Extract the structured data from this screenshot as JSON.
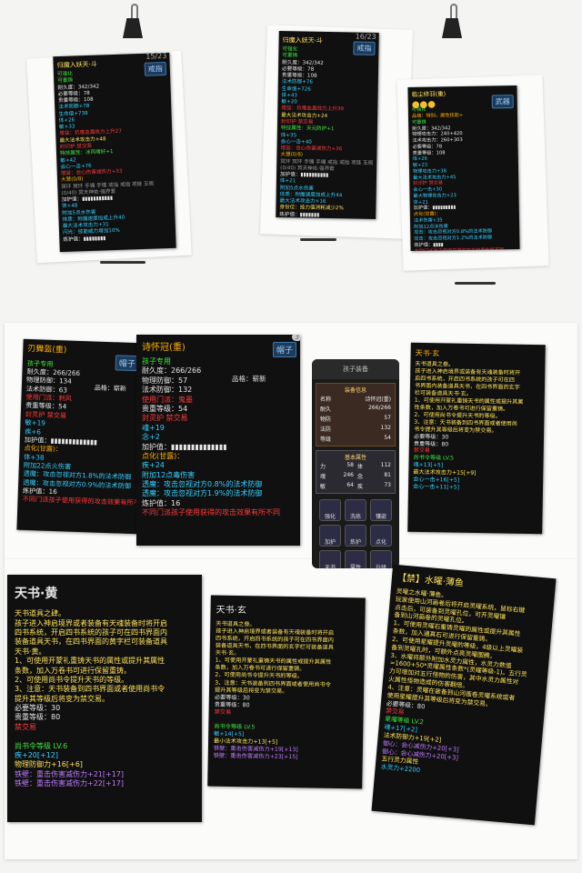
{
  "card1": {
    "title": "归魔入妖天·斗",
    "badge": "戒指",
    "pagemark": "15/23",
    "lines": [
      {
        "t": "可强化",
        "c": "grn"
      },
      {
        "t": "可重铸",
        "c": "grn"
      },
      {
        "t": "耐久度：342/342",
        "c": "wht"
      },
      {
        "t": "必要等级：78",
        "c": "wht"
      },
      {
        "t": "贵重等级：108",
        "c": "wht"
      },
      {
        "t": "法术防御+78",
        "c": "cyn"
      },
      {
        "t": "生命值+739",
        "c": "cyn"
      },
      {
        "t": "体+26",
        "c": "cyn"
      },
      {
        "t": "敏+33",
        "c": "cyn"
      },
      {
        "t": "增益：抗嗜血蛊效力上升27",
        "c": "red"
      },
      {
        "t": "最大法术攻击力+48",
        "c": "yel"
      },
      {
        "t": "封印护 禁交易",
        "c": "red"
      },
      {
        "t": "特技属性：冰风嗜好+1",
        "c": "grn"
      },
      {
        "t": "敏+42",
        "c": "cyn"
      },
      {
        "t": "会心一击+76",
        "c": "cyn"
      },
      {
        "t": "增益：会心伤害减伤力+33",
        "c": "red"
      },
      {
        "t": "大慧(0/8)",
        "c": "orn"
      },
      {
        "t": "冥环 冥环 手镯 手镯 戒指 戒指 项链 玉佩",
        "c": "gry"
      },
      {
        "t": "(0/40) 冥天神佑·强界套",
        "c": "gry"
      },
      {
        "t": "加护值：▮▮▮▮▮▮▮▮▮▮▮",
        "c": "wht"
      },
      {
        "t": "体+48",
        "c": "cyn"
      },
      {
        "t": "附加5点水伤害",
        "c": "cyn"
      },
      {
        "t": "体质：附魔速度加成上升40",
        "c": "cyn"
      },
      {
        "t": "最大法术攻击力+31",
        "c": "cyn"
      },
      {
        "t": "闪光：技能威力增加10%",
        "c": "cyn"
      },
      {
        "t": "炼护值：▮▮▮▮▮▮▮▮",
        "c": "wht"
      }
    ]
  },
  "card2": {
    "title": "归魔入妖天·斗",
    "badge": "戒指",
    "pagemark": "16/23",
    "lines": [
      {
        "t": "可强化",
        "c": "grn"
      },
      {
        "t": "可重铸",
        "c": "grn"
      },
      {
        "t": "耐久度：342/342",
        "c": "wht"
      },
      {
        "t": "必要等级：78",
        "c": "wht"
      },
      {
        "t": "贵重等级：108",
        "c": "wht"
      },
      {
        "t": "法术防御+76",
        "c": "cyn"
      },
      {
        "t": "生命值+726",
        "c": "cyn"
      },
      {
        "t": "体+43",
        "c": "cyn"
      },
      {
        "t": "敏+20",
        "c": "cyn"
      },
      {
        "t": "增益：抗嗜血蛊效力上升39",
        "c": "red"
      },
      {
        "t": "最大法术攻击力+24",
        "c": "yel"
      },
      {
        "t": "封印护 禁交易",
        "c": "red"
      },
      {
        "t": "特技属性：天元防护+1",
        "c": "grn"
      },
      {
        "t": "体+35",
        "c": "cyn"
      },
      {
        "t": "会心一击+40",
        "c": "cyn"
      },
      {
        "t": "增益：会心伤害减伤力+36",
        "c": "red"
      },
      {
        "t": "大慧(0/8)",
        "c": "orn"
      },
      {
        "t": "冥环 冥环 手镯 手镯 戒指 戒指 项链 玉佩",
        "c": "gry"
      },
      {
        "t": "(0/40) 冥天神佑·强界套",
        "c": "gry"
      },
      {
        "t": "加护值：▮▮▮▮▮▮▮▮▮▮",
        "c": "wht"
      },
      {
        "t": "体+21",
        "c": "cyn"
      },
      {
        "t": "附加5点水伤害",
        "c": "cyn"
      },
      {
        "t": "体质：附魔速度加成上升44",
        "c": "cyn"
      },
      {
        "t": "最大法术攻击力+16",
        "c": "cyn"
      },
      {
        "t": "身份位：技力值消耗减少2%",
        "c": "yel"
      },
      {
        "t": "炼护值：▮▮▮▮▮▮▮",
        "c": "wht"
      }
    ]
  },
  "card3": {
    "title": "临尘修羽(重)",
    "badge": "武器",
    "pagemark": "",
    "lines": [
      {
        "t": "可强化",
        "c": "grn"
      },
      {
        "t": "品格：特别，属性技能+",
        "c": "orn"
      },
      {
        "t": "可重铸",
        "c": "grn"
      },
      {
        "t": "耐久度：342/342",
        "c": "wht"
      },
      {
        "t": "物理攻击力：240+420",
        "c": "wht"
      },
      {
        "t": "法术攻击力：260+303",
        "c": "wht"
      },
      {
        "t": "必要等级：78",
        "c": "wht"
      },
      {
        "t": "贵重等级：108",
        "c": "wht"
      },
      {
        "t": "体+26",
        "c": "cyn"
      },
      {
        "t": "敏+23",
        "c": "cyn"
      },
      {
        "t": "物理攻击力+38",
        "c": "cyn"
      },
      {
        "t": "最大法术攻击力+45",
        "c": "cyn"
      },
      {
        "t": "封印护 禁交易",
        "c": "red"
      },
      {
        "t": "会心一击+30",
        "c": "cyn"
      },
      {
        "t": "最大物理攻击力+23",
        "c": "cyn"
      },
      {
        "t": "体+21",
        "c": "cyn"
      },
      {
        "t": "加护值：▮▮▮▮▮▮▮▮▮",
        "c": "wht"
      },
      {
        "t": "点化(甘露)：",
        "c": "orn"
      },
      {
        "t": "法术伤害+35",
        "c": "cyn"
      },
      {
        "t": "附加12点冰伤害",
        "c": "cyn"
      },
      {
        "t": "攻击：攻击忽视对方0.8%的法术防御",
        "c": "cyn"
      },
      {
        "t": "攻击：攻击忽视对方1.2%的法术防御",
        "c": "cyn"
      },
      {
        "t": "炼护值：▮▮▮▮",
        "c": "wht"
      },
      {
        "t": "不同门派孩子使用获得的攻击效果有所不同",
        "c": "red"
      }
    ]
  },
  "card4": {
    "title": "刃舞盔(重)",
    "badge": "帽子",
    "lines": [
      {
        "t": "孩子专用",
        "c": "grn"
      },
      {
        "t": "耐久度：266/266",
        "c": "wht"
      },
      {
        "t": "物理防御：134",
        "c": "wht"
      },
      {
        "t": "法术防御：63",
        "c": "wht"
      },
      {
        "t": "使用门派：刺风",
        "c": "red"
      },
      {
        "t": "贵重等级：54",
        "c": "wht"
      },
      {
        "t": "封灵护 禁交易",
        "c": "red"
      },
      {
        "t": "敏+19",
        "c": "cyn"
      },
      {
        "t": "疾+6",
        "c": "cyn"
      },
      {
        "t": "加护值：▮▮▮▮▮▮▮▮▮▮▮▮▮",
        "c": "wht"
      },
      {
        "t": "点化(甘露)：",
        "c": "orn"
      },
      {
        "t": "体+38",
        "c": "cyn"
      },
      {
        "t": "附加22点火伤害",
        "c": "cyn"
      },
      {
        "t": "透魔：攻击忽视对方1.8%的法术防御",
        "c": "cyn"
      },
      {
        "t": "透魔：攻击忽视对方0.9%的法术防御",
        "c": "cyn"
      },
      {
        "t": "炼护值：16",
        "c": "wht"
      },
      {
        "t": "不同门派孩子使用获得的攻击效果有所不同",
        "c": "red"
      }
    ],
    "quality": "品格：崭新"
  },
  "card5": {
    "title": "诗怀冠(重)",
    "badge": "帽子",
    "pagemark": "3",
    "lines": [
      {
        "t": "孩子专用",
        "c": "grn"
      },
      {
        "t": "耐久度：266/266",
        "c": "wht"
      },
      {
        "t": "物理防御：57",
        "c": "wht"
      },
      {
        "t": "法术防御：132",
        "c": "wht"
      },
      {
        "t": "使用门派：鬼墨",
        "c": "red"
      },
      {
        "t": "贵重等级：54",
        "c": "wht"
      },
      {
        "t": "封灵护 禁交易",
        "c": "red"
      },
      {
        "t": "魂+19",
        "c": "cyn"
      },
      {
        "t": "念+2",
        "c": "cyn"
      },
      {
        "t": "加护值：▮▮▮▮▮▮▮▮▮▮▮▮▮▮",
        "c": "wht"
      },
      {
        "t": "点化(甘露)：",
        "c": "orn"
      },
      {
        "t": "疾+24",
        "c": "cyn"
      },
      {
        "t": "附加12点毒伤害",
        "c": "cyn"
      },
      {
        "t": "透魔：攻击忽视对方0.8%的法术防御",
        "c": "cyn"
      },
      {
        "t": "透魔：攻击忽视对方1.9%的法术防御",
        "c": "cyn"
      },
      {
        "t": "炼护值：16",
        "c": "wht"
      },
      {
        "t": "不同门派孩子使用获得的攻击效果有所不同",
        "c": "red"
      }
    ],
    "quality": "品格：崭新"
  },
  "phone": {
    "title": "孩子装备",
    "panel_title": "装备信息",
    "rows": [
      {
        "k": "名称",
        "v": "诗怀冠(重)"
      },
      {
        "k": "耐久",
        "v": "266/266"
      },
      {
        "k": "物防",
        "v": "57"
      },
      {
        "k": "法防",
        "v": "132"
      },
      {
        "k": "等级",
        "v": "54"
      }
    ],
    "stats_title": "基本属性",
    "stats": [
      {
        "k": "力",
        "v": "58"
      },
      {
        "k": "体",
        "v": "112"
      },
      {
        "k": "魂",
        "v": "246"
      },
      {
        "k": "念",
        "v": "81"
      },
      {
        "k": "敏",
        "v": "64"
      },
      {
        "k": "疾",
        "v": "73"
      }
    ],
    "icons": [
      "强化",
      "洗练",
      "镶嵌",
      "加护",
      "炼护",
      "点化",
      "天书",
      "属性",
      "升级"
    ]
  },
  "card6": {
    "title": "天书·玄",
    "lines": [
      {
        "t": "天书道具之叁。",
        "c": "yel"
      },
      {
        "t": "孩子进入神启境界或装备有天魂装备时将开",
        "c": "yel"
      },
      {
        "t": "启四书系统，开启四书系统的孩子可在四",
        "c": "yel"
      },
      {
        "t": "书界面内装备道具天书，在四书界面的玄字",
        "c": "yel"
      },
      {
        "t": "栏可装备道具天书·玄。",
        "c": "yel"
      },
      {
        "t": "1、可使用开蒙礼重铸天书的属性或提升其属",
        "c": "yel"
      },
      {
        "t": "性条数，加入万卷书可进行保留重铸。",
        "c": "yel"
      },
      {
        "t": "2、可使用尚书令提升天书的等级。",
        "c": "yel"
      },
      {
        "t": "3、注意：天书装备到四书界面或者使用尚",
        "c": "yel"
      },
      {
        "t": "书令提升其等级后将变为禁交易。",
        "c": "yel"
      },
      {
        "t": "必要等级：30",
        "c": "wht"
      },
      {
        "t": "贵重等级：80",
        "c": "wht"
      },
      {
        "t": "禁交易",
        "c": "red"
      },
      {
        "t": "尚书令等级 LV.5",
        "c": "grn"
      },
      {
        "t": "魂+13[+5]",
        "c": "cyn"
      },
      {
        "t": "最大法术攻击力+15[+9]",
        "c": "yel"
      },
      {
        "t": "会心一击+16[+5]",
        "c": "cyn"
      },
      {
        "t": "会心一击+11[+5]",
        "c": "cyn"
      }
    ]
  },
  "card7": {
    "title": "天书·黄",
    "lines": [
      {
        "t": "天书道具之肆。",
        "c": "yel"
      },
      {
        "t": "孩子进入神启境界或者装备有天魂装备时将开启",
        "c": "yel"
      },
      {
        "t": "四书系统，开启四书系统的孩子可在四书界面内",
        "c": "yel"
      },
      {
        "t": "装备道具天书，在四书界面的黄字栏可装备道具",
        "c": "yel"
      },
      {
        "t": "天书·黄。",
        "c": "yel"
      },
      {
        "t": "1、可使用开蒙礼重铸天书的属性或提升其属性",
        "c": "yel"
      },
      {
        "t": "条数，加入万卷书可进行保留重铸。",
        "c": "yel"
      },
      {
        "t": "2、可使用尚书令提升天书的等级。",
        "c": "yel"
      },
      {
        "t": "3、注意：天书装备到四书界面或者使用尚书令",
        "c": "yel"
      },
      {
        "t": "提升其等级后将变为禁交易。",
        "c": "yel"
      },
      {
        "t": "必要等级：30",
        "c": "wht"
      },
      {
        "t": "贵重等级：80",
        "c": "wht"
      },
      {
        "t": "禁交易",
        "c": "red"
      },
      {
        "t": "",
        "c": "wht"
      },
      {
        "t": "尚书令等级 LV.6",
        "c": "grn"
      },
      {
        "t": "疾+20[+12]",
        "c": "cyn"
      },
      {
        "t": "物理防御力+16[+6]",
        "c": "yel"
      },
      {
        "t": "铁壁：重击伤害减伤力+21[+17]",
        "c": "pur"
      },
      {
        "t": "铁壁：重击伤害减伤力+22[+17]",
        "c": "pur"
      }
    ]
  },
  "card8": {
    "title": "天书·玄",
    "lines": [
      {
        "t": "天书道具之叁。",
        "c": "yel"
      },
      {
        "t": "孩子进入神启境界或者装备有天魂装备时将开启",
        "c": "yel"
      },
      {
        "t": "四书系统，开启四书系统的孩子可在四书界面内",
        "c": "yel"
      },
      {
        "t": "装备道具天书，在四书界面的玄字栏可装备道具",
        "c": "yel"
      },
      {
        "t": "天书·玄。",
        "c": "yel"
      },
      {
        "t": "1、可使用开蒙礼重铸天书的属性或提升其属性",
        "c": "yel"
      },
      {
        "t": "条数，加入万卷书可进行保留重铸。",
        "c": "yel"
      },
      {
        "t": "2、可使用尚书令提升天书的等级。",
        "c": "yel"
      },
      {
        "t": "3、注意：天书装备到四书界面或者使用尚书令",
        "c": "yel"
      },
      {
        "t": "提升其等级后将变为禁交易。",
        "c": "yel"
      },
      {
        "t": "必要等级：30",
        "c": "wht"
      },
      {
        "t": "贵重等级：80",
        "c": "wht"
      },
      {
        "t": "禁交易",
        "c": "red"
      },
      {
        "t": "",
        "c": "wht"
      },
      {
        "t": "尚书令等级 LV.5",
        "c": "grn"
      },
      {
        "t": "敏+14[+5]",
        "c": "cyn"
      },
      {
        "t": "最小法术攻击力+13[+5]",
        "c": "yel"
      },
      {
        "t": "铁壁：重击伤害减伤力+19[+13]",
        "c": "pur"
      },
      {
        "t": "铁壁：重击伤害减伤力+23[+15]",
        "c": "pur"
      }
    ]
  },
  "card9": {
    "title": "【禁】水曜·薄鱼",
    "lines": [
      {
        "t": "灵曜之水曜·薄鱼。",
        "c": "yel"
      },
      {
        "t": "玩家使用山河画卷后将开启灵曜系统，鼠标右键",
        "c": "yel"
      },
      {
        "t": "点击后，可装备到灵曜孔位，可开灵曜镶",
        "c": "yel"
      },
      {
        "t": "备到山河画卷的灵曜孔位。",
        "c": "yel"
      },
      {
        "t": "1、可使用灵曜石重铸灵曜的属性或提升其属性",
        "c": "yel"
      },
      {
        "t": "条数，加入通真石可进行保留重铸。",
        "c": "yel"
      },
      {
        "t": "2、可使用星耀提升灵曜的等级，4级以上灵曜装",
        "c": "yel"
      },
      {
        "t": "备到灵曜孔时，可额外点亮灵曜图腾。",
        "c": "yel"
      },
      {
        "t": "3、水曜将额外附加水灵力属性，水灵力数值",
        "c": "yel"
      },
      {
        "t": "=1600+50*灵曜属性条数*(灵曜等级-1)。五行灵",
        "c": "yel"
      },
      {
        "t": "力可增加对五行怪物的伤害，其中水灵力属性对",
        "c": "yel"
      },
      {
        "t": "火属性怪物造成的伤害翻倍。",
        "c": "yel"
      },
      {
        "t": "4、注意：灵曜在装备到山河画卷灵曜系统或者",
        "c": "yel"
      },
      {
        "t": "使用星耀提升其等级后将变为禁交易。",
        "c": "yel"
      },
      {
        "t": "必要等级：80",
        "c": "wht"
      },
      {
        "t": "禁交易",
        "c": "red"
      },
      {
        "t": "星曜等级 LV.2",
        "c": "grn"
      },
      {
        "t": "魂+17[+2]",
        "c": "cyn"
      },
      {
        "t": "法术防御力+19[+2]",
        "c": "yel"
      },
      {
        "t": "御心：会心减伤力+20[+3]",
        "c": "pur"
      },
      {
        "t": "御心：会心减伤力+20[+3]",
        "c": "pur"
      },
      {
        "t": "五行灵力属性",
        "c": "yel"
      },
      {
        "t": "水灵力+2200",
        "c": "cyn"
      }
    ]
  }
}
